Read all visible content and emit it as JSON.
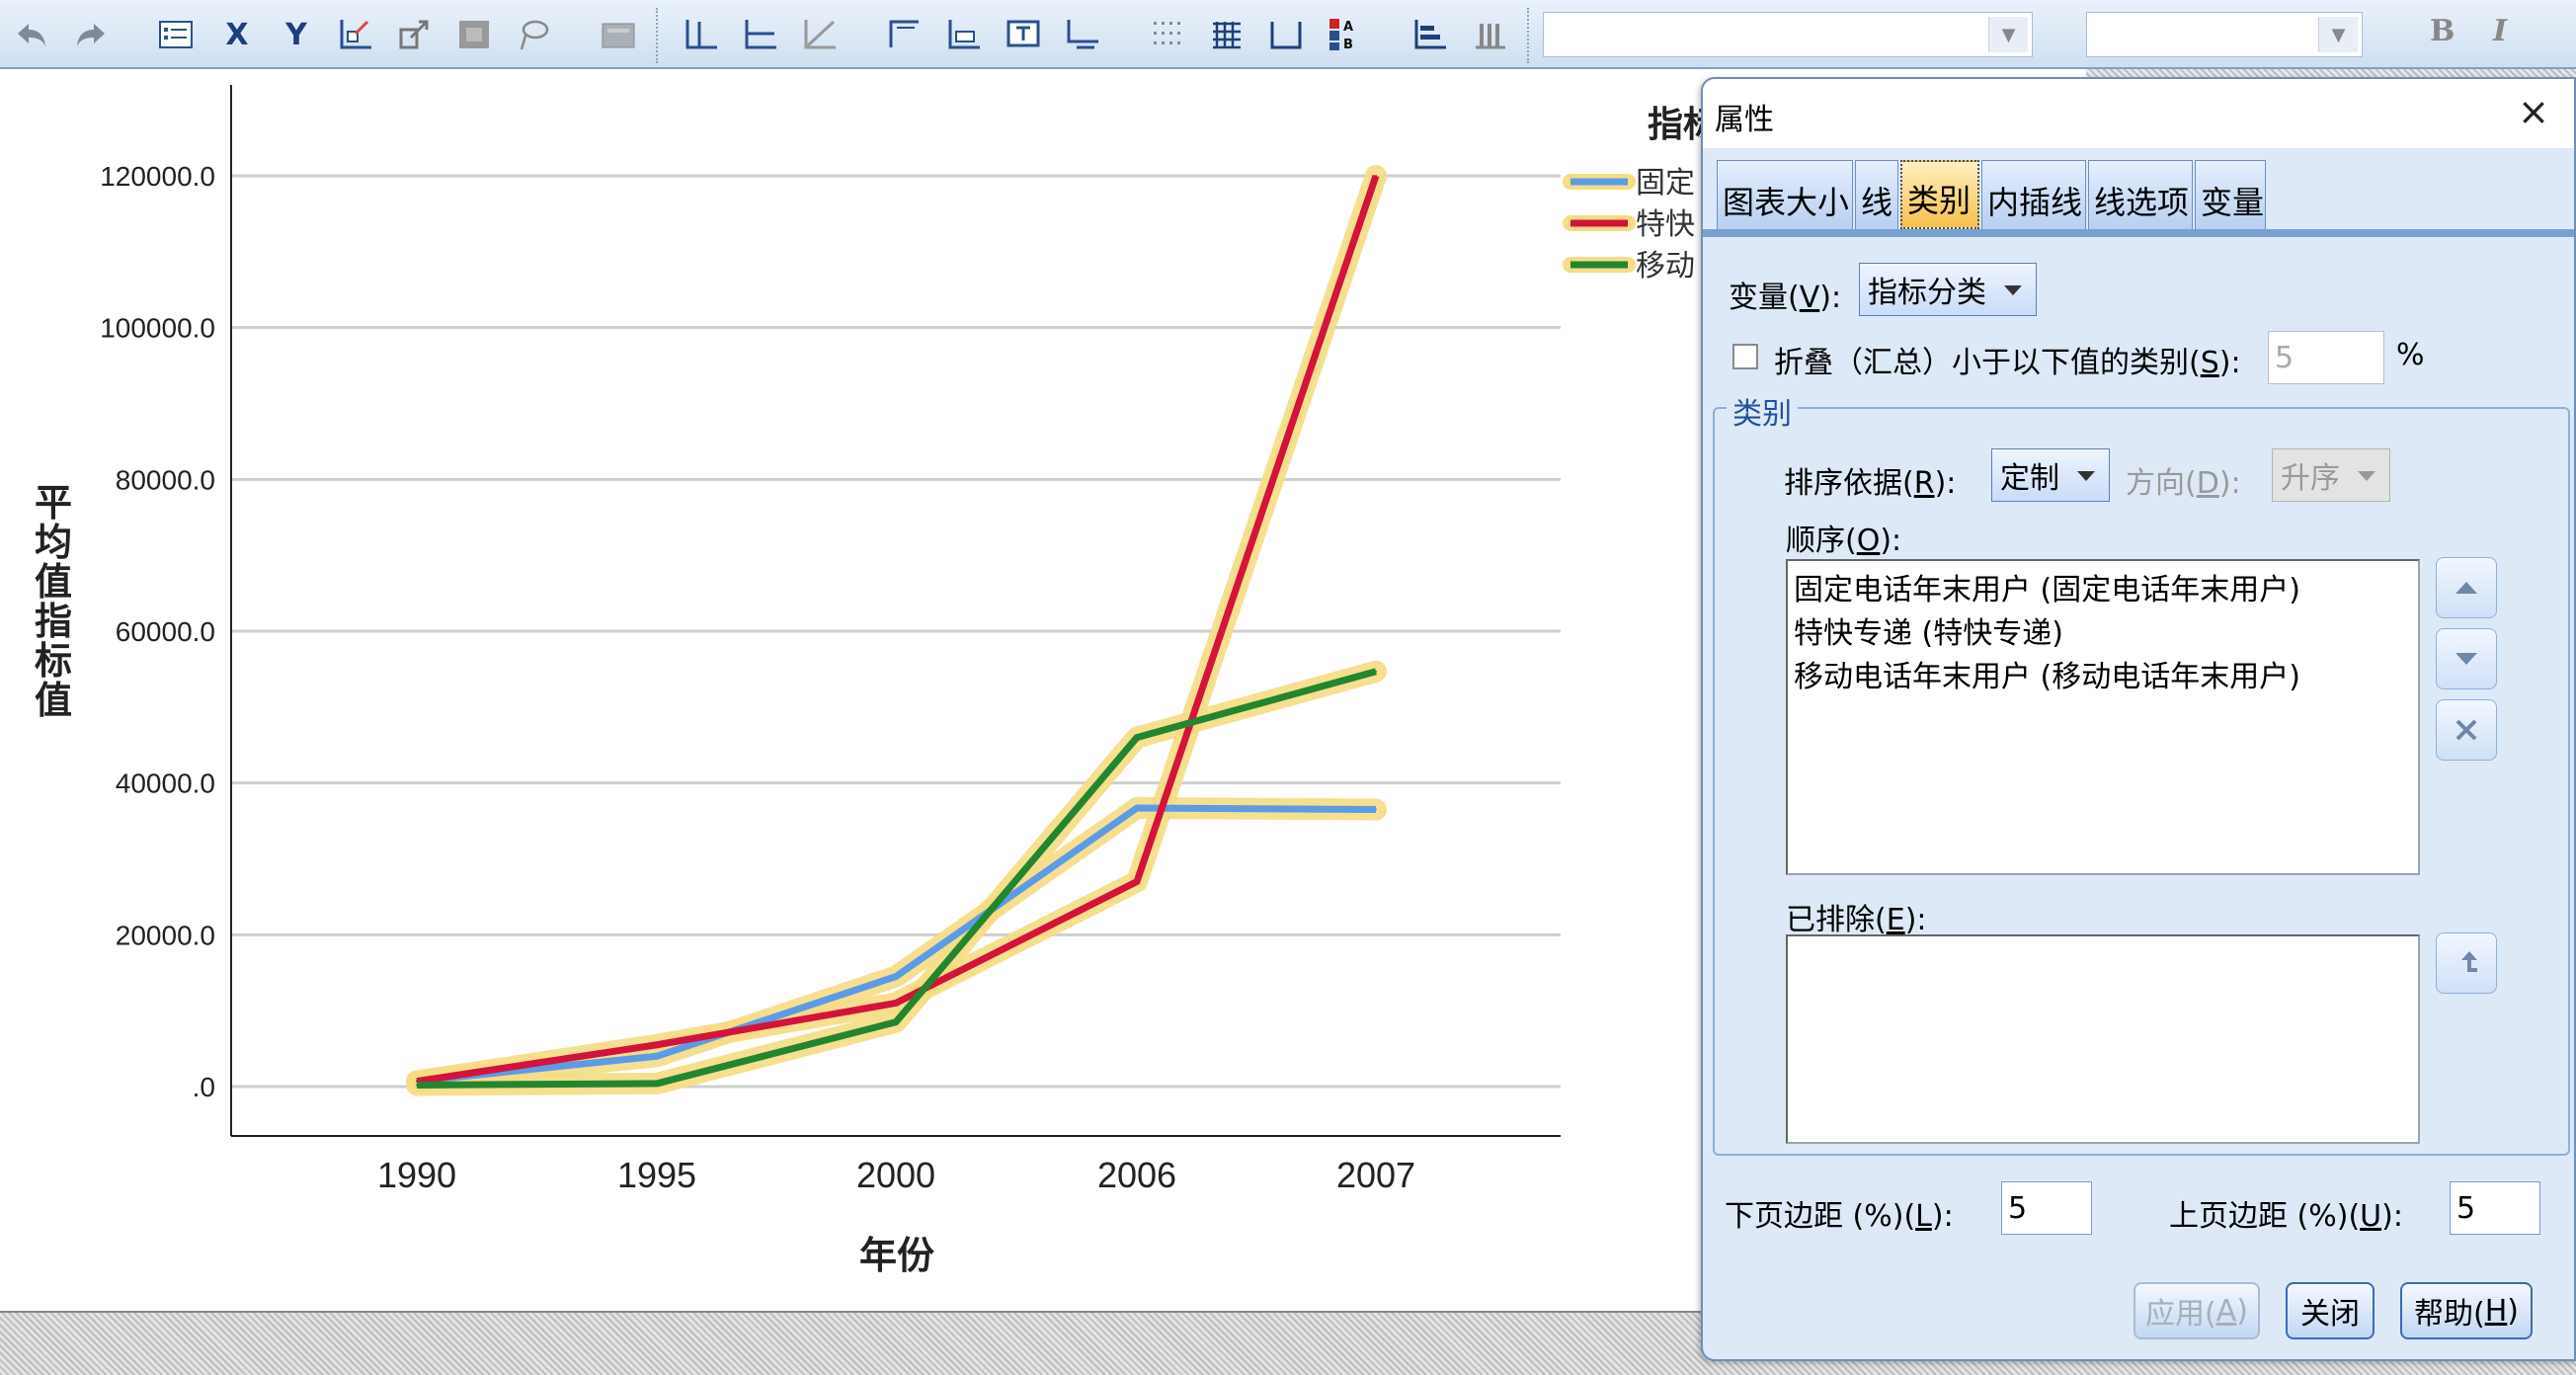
{
  "toolbar": {
    "undo_icon": "undo-icon",
    "redo_icon": "redo-icon",
    "x_label": "X",
    "y_label": "Y",
    "font_combo_value": "",
    "size_combo_value": "",
    "bold_label": "B",
    "italic_label": "I"
  },
  "chart": {
    "ylabel": "平均值指标值",
    "xlabel": "年份",
    "legend_title_partial": "指标",
    "legend_items": [
      {
        "label": "固定",
        "color": "#5b9be8"
      },
      {
        "label": "特快",
        "color": "#d4133a"
      },
      {
        "label": "移动",
        "color": "#22862f"
      }
    ]
  },
  "chart_data": {
    "type": "line",
    "x": [
      "1990",
      "1995",
      "2000",
      "2006",
      "2007"
    ],
    "series": [
      {
        "name": "固定电话年末用户",
        "color": "#5b9be8",
        "values": [
          700,
          4000,
          14500,
          36700,
          36500
        ]
      },
      {
        "name": "特快专递",
        "color": "#d4133a",
        "values": [
          700,
          5500,
          11000,
          27000,
          120000
        ]
      },
      {
        "name": "移动电话年末用户",
        "color": "#22862f",
        "values": [
          200,
          400,
          8500,
          46000,
          54700
        ]
      }
    ],
    "yticks": [
      ".0",
      "20000.0",
      "40000.0",
      "60000.0",
      "80000.0",
      "100000.0",
      "120000.0"
    ],
    "ylim": [
      0,
      120000
    ],
    "xlabel": "年份",
    "ylabel": "平均值指标值",
    "grid": "horizontal"
  },
  "dialog": {
    "title": "属性",
    "close_glyph": "×",
    "tabs": [
      "图表大小",
      "线",
      "类别",
      "内插线",
      "线选项",
      "变量"
    ],
    "active_tab": "类别",
    "variable_label": "变量(",
    "variable_key": "V",
    "variable_suffix": "):",
    "variable_value": "指标分类",
    "collapse_label": "折叠（汇总）小于以下值的类别(",
    "collapse_key": "S",
    "collapse_suffix": "):",
    "collapse_value": "5",
    "percent": "%",
    "group_title": "类别",
    "sort_label": "排序依据(",
    "sort_key": "R",
    "sort_suffix": "):",
    "sort_value": "定制",
    "direction_label": "方向(",
    "direction_key": "D",
    "direction_suffix": "):",
    "direction_value": "升序",
    "order_label": "顺序(",
    "order_key": "O",
    "order_suffix": "):",
    "order_items": [
      "固定电话年末用户 (固定电话年末用户)",
      "特快专递 (特快专递)",
      "移动电话年末用户 (移动电话年末用户)"
    ],
    "excluded_label": "已排除(",
    "excluded_key": "E",
    "excluded_suffix": "):",
    "lower_margin_label": "下页边距 (%)(",
    "lower_margin_key": "L",
    "lower_margin_suffix": "):",
    "lower_margin_value": "5",
    "upper_margin_label": "上页边距 (%)(",
    "upper_margin_key": "U",
    "upper_margin_suffix": "):",
    "upper_margin_value": "5",
    "apply_label": "应用(",
    "apply_key": "A",
    "close_label": "关闭",
    "help_label": "帮助(",
    "help_key": "H",
    "paren_close": ")"
  }
}
